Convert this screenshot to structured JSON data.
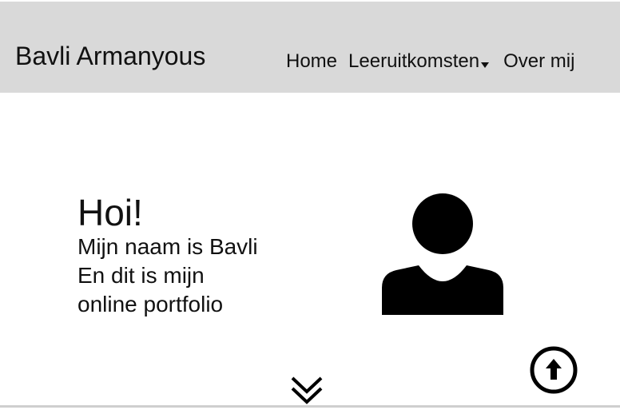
{
  "header": {
    "brand": "Bavli Armanyous",
    "nav": {
      "home": "Home",
      "leeruitkomsten": "Leeruitkomsten",
      "over_mij": "Over mij"
    }
  },
  "hero": {
    "greeting": "Hoi!",
    "line1": "Mijn naam is Bavli",
    "line2": "En dit is mijn",
    "line3": "online portfolio"
  },
  "icons": {
    "avatar": "user-avatar-icon",
    "scroll_down": "double-chevron-down-icon",
    "back_to_top": "arrow-up-circle-icon",
    "dropdown": "caret-down-icon"
  },
  "colors": {
    "navbar_bg": "#d9d9d9",
    "text": "#111111",
    "background": "#ffffff"
  }
}
